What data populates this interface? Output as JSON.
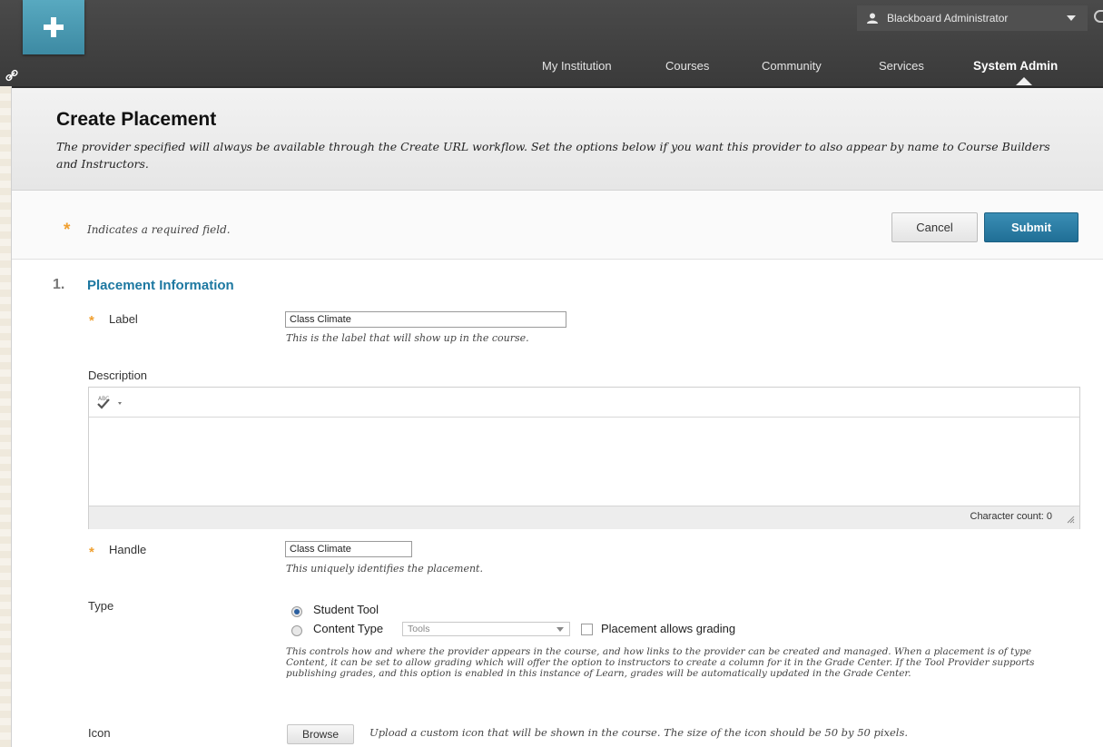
{
  "colors": {
    "accent": "#1d78a1",
    "submit": "#206f96",
    "required_star": "#f0a030",
    "topbar": "#3f3f3f"
  },
  "user_menu": {
    "name": "Blackboard Administrator",
    "icon": "person-icon"
  },
  "nav": {
    "tabs": [
      {
        "label": "My Institution"
      },
      {
        "label": "Courses"
      },
      {
        "label": "Community"
      },
      {
        "label": "Services"
      },
      {
        "label": "System Admin",
        "active": true
      }
    ]
  },
  "header": {
    "title": "Create Placement",
    "description": "The provider specified will always be available through the Create URL workflow. Set the options below if you want this provider to also appear by name to Course Builders and Instructors."
  },
  "actions": {
    "required_star": "*",
    "required_note": "Indicates a required field.",
    "cancel_label": "Cancel",
    "submit_label": "Submit"
  },
  "section": {
    "number": "1.",
    "title": "Placement Information"
  },
  "fields": {
    "label": {
      "label": "Label",
      "value": "Class Climate",
      "help": "This is the label that will show up in the course."
    },
    "description": {
      "label": "Description",
      "char_count": "Character count: 0"
    },
    "handle": {
      "label": "Handle",
      "value": "Class Climate",
      "help": "This uniquely identifies the placement."
    },
    "type": {
      "label": "Type",
      "option_student_tool": "Student Tool",
      "option_content_type": "Content Type",
      "selected": "Student Tool",
      "content_type_select": "Tools",
      "grading_checkbox_label": "Placement allows grading",
      "grading_checked": false,
      "help": "This controls how and where the provider appears in the course, and how links to the provider can be created and managed. When a placement is of type Content, it can be set to allow grading which will offer the option to instructors to create a column for it in the Grade Center. If the Tool Provider supports publishing grades, and this option is enabled in this instance of Learn, grades will be automatically updated in the Grade Center."
    },
    "icon": {
      "label": "Icon",
      "browse_label": "Browse",
      "help": "Upload a custom icon that will be shown in the course. The size of the icon should be 50 by 50 pixels."
    }
  }
}
